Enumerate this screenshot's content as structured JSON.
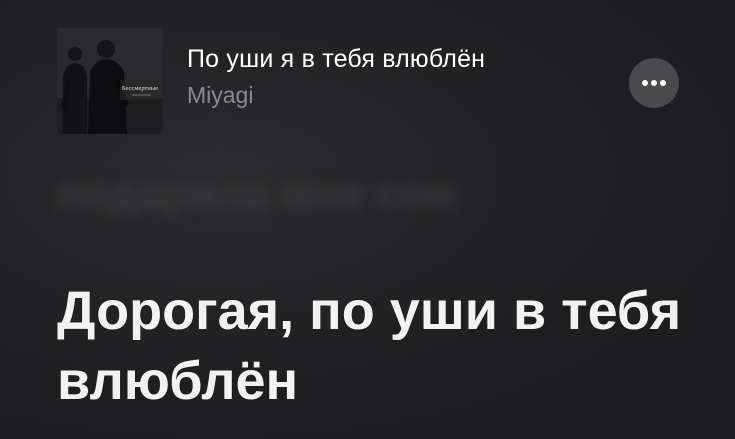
{
  "now_playing": {
    "title": "По уши я в тебя влюблён",
    "artist": "Miyagi",
    "artwork_text": "Бессмертные"
  },
  "lyrics": {
    "previous_line": "подарила мне сон",
    "current_line": "Дорогая, по уши в тебя влюблён"
  },
  "controls": {
    "more_icon": "more-horizontal-icon"
  },
  "colors": {
    "background": "#1f1f21",
    "artist_text": "#8b8b8e",
    "more_button": "#4a4a4d",
    "dimmed_lyric": "#3b3b3e"
  }
}
